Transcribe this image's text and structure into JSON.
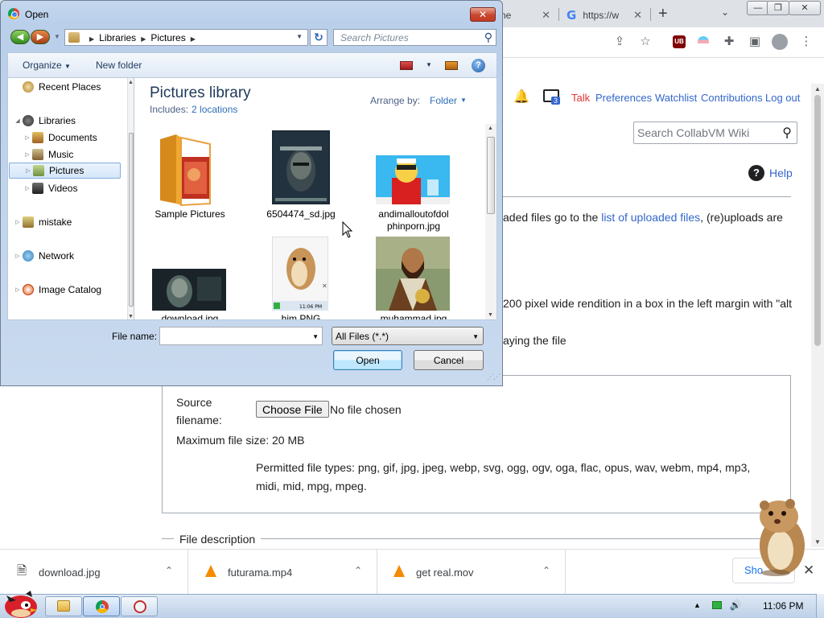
{
  "browser": {
    "tabs": [
      {
        "label": "ew me",
        "close": "✕"
      },
      {
        "label": "https://w",
        "favicon": "G",
        "close": "✕"
      }
    ],
    "new_tab": "+",
    "tab_search": "⌄",
    "window_buttons": {
      "minimize": "—",
      "restore": "❐",
      "close": "✕"
    },
    "toolbar_icons": [
      "share-icon",
      "star-icon",
      "ublock-icon",
      "trans-flag-icon",
      "puzzle-extensions-icon",
      "side-panel-icon",
      "profile-avatar-icon",
      "kebab-menu-icon"
    ],
    "ublock_text": "UB"
  },
  "wiki": {
    "personal": {
      "notices_count": "3",
      "talk": "Talk",
      "preferences": "Preferences",
      "watchlist": "Watchlist",
      "contributions": "Contributions",
      "logout": "Log out"
    },
    "search_placeholder": "Search CollabVM Wiki",
    "help": "Help",
    "para1_pre": "aded files go to the ",
    "para1_link": "list of uploaded files",
    "para1_post": ", (re)uploads are",
    "para2": "200 pixel wide rendition in a box in the left margin with \"alt",
    "para3": "aying the file",
    "source_filename_label": "Source filename:",
    "choose_file": "Choose File",
    "no_file": "No file chosen",
    "max_size": "Maximum file size: 20 MB",
    "permitted": "Permitted file types: png, gif, jpg, jpeg, webp, svg, ogg, ogv, oga, flac, opus, wav, webm, mp4, mp3, midi, mid, mpg, mpeg.",
    "file_description": "File description"
  },
  "downloads": {
    "items": [
      {
        "name": "download.jpg",
        "icon": "image-file-icon"
      },
      {
        "name": "futurama.mp4",
        "icon": "vlc-cone-icon"
      },
      {
        "name": "get real.mov",
        "icon": "vlc-cone-icon"
      }
    ],
    "show_all": "Sho",
    "close": "✕"
  },
  "taskbar": {
    "clock": "11:06 PM",
    "tray_icons": [
      "tray-up-arrow-icon",
      "network-icon",
      "volume-icon"
    ]
  },
  "dialog": {
    "title": "Open",
    "close": "✕",
    "address": [
      "Libraries",
      "Pictures"
    ],
    "search_placeholder": "Search Pictures",
    "organize": "Organize",
    "new_folder": "New folder",
    "help": "?",
    "nav": [
      {
        "label": "Recent Places",
        "indent": 2,
        "top": 0,
        "expand": ""
      },
      {
        "label": "Libraries",
        "indent": 0,
        "expand": "◢"
      },
      {
        "label": "Documents",
        "indent": 1,
        "expand": "▷"
      },
      {
        "label": "Music",
        "indent": 1,
        "expand": "▷"
      },
      {
        "label": "Pictures",
        "indent": 1,
        "expand": "▷",
        "selected": true
      },
      {
        "label": "Videos",
        "indent": 1,
        "expand": "▷"
      },
      {
        "label": "mistake",
        "indent": 0,
        "expand": "▷"
      },
      {
        "label": "Network",
        "indent": 0,
        "expand": "▷"
      },
      {
        "label": "Image Catalog",
        "indent": 0,
        "expand": "▷"
      }
    ],
    "library_title": "Pictures library",
    "includes_label": "Includes:",
    "includes_value": "2 locations",
    "arrange_label": "Arrange by:",
    "arrange_value": "Folder",
    "files": [
      {
        "name": "Sample Pictures"
      },
      {
        "name": "6504474_sd.jpg"
      },
      {
        "name": "andimalloutofdol phinporn.jpg"
      },
      {
        "name": "download.jpg"
      },
      {
        "name": "him.PNG"
      },
      {
        "name": "muhammad.jpg"
      }
    ],
    "thumb_text": {
      "him_time": "11:06 PM"
    },
    "file_name_label": "File name:",
    "file_name_value": "",
    "filter": "All Files (*.*)",
    "open": "Open",
    "cancel": "Cancel"
  }
}
